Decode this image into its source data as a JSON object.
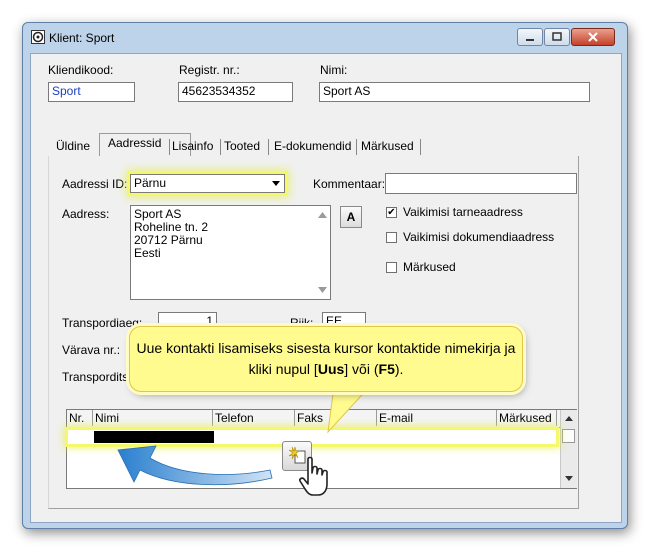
{
  "window": {
    "title": "Klient: Sport",
    "controls": [
      "minimize-icon",
      "maximize-icon",
      "close-icon"
    ]
  },
  "header": {
    "code_label": "Kliendikood:",
    "code_value": "Sport",
    "reg_label": "Registr. nr.:",
    "reg_value": "45623534352",
    "name_label": "Nimi:",
    "name_value": "Sport AS"
  },
  "tabs": [
    {
      "label": "Üldine",
      "active": false
    },
    {
      "label": "Aadressid",
      "active": true
    },
    {
      "label": "Lisainfo",
      "active": false
    },
    {
      "label": "Tooted",
      "active": false
    },
    {
      "label": "E-dokumendid",
      "active": false
    },
    {
      "label": "Märkused",
      "active": false
    }
  ],
  "address_tab": {
    "address_id_label": "Aadressi ID:",
    "address_id_value": "Pärnu",
    "comment_label": "Kommentaar:",
    "comment_value": "",
    "address_label": "Aadress:",
    "address_lines": [
      "Sport AS",
      "Roheline tn. 2",
      "20712 Pärnu",
      "Eesti"
    ],
    "font_button": "A",
    "checkboxes": [
      {
        "label": "Vaikimisi tarneaadress",
        "checked": true
      },
      {
        "label": "Vaikimisi dokumendiaadress",
        "checked": false
      },
      {
        "label": "Märkused",
        "checked": false
      }
    ],
    "transport_days_label": "Transpordiaeg:",
    "transport_days_value": "1",
    "country_label": "Riik:",
    "country_value": "EE",
    "gate_label": "Värava nr.:",
    "transport_company_label": "Transporditso"
  },
  "contacts_grid": {
    "columns": [
      "Nr.",
      "Nimi",
      "Telefon",
      "Faks",
      "E-mail",
      "Märkused"
    ]
  },
  "callout": {
    "text_before": "Uue kontakti lisamiseks sisesta kursor kontaktide nimekirja ja kliki nupul [",
    "bold_1": "Uus",
    "text_mid": "] või (",
    "bold_2": "F5",
    "text_after": ")."
  },
  "colors": {
    "highlight": "#f4f86a",
    "callout_bg": "#fffb8f",
    "arrow": "#3b8fd6"
  }
}
